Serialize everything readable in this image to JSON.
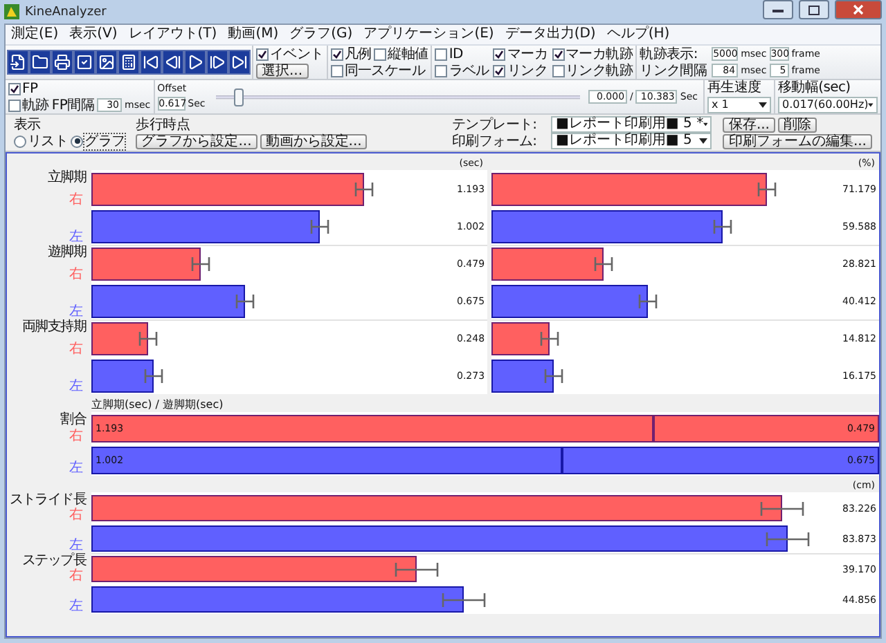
{
  "window": {
    "title": "KineAnalyzer"
  },
  "menu": [
    {
      "label": "測定(E)"
    },
    {
      "label": "表示(V)"
    },
    {
      "label": "レイアウト(T)"
    },
    {
      "label": "動画(M)"
    },
    {
      "label": "グラフ(G)"
    },
    {
      "label": "アプリケーション(E)"
    },
    {
      "label": "データ出力(D)"
    },
    {
      "label": "ヘルプ(H)"
    }
  ],
  "toolbar": {
    "events": {
      "label": "イベント",
      "checked": true
    },
    "select_button": "選択...",
    "legend": {
      "label": "凡例",
      "checked": true
    },
    "axis_values": {
      "label": "縦軸値",
      "checked": false
    },
    "same_scale": {
      "label": "同一スケール",
      "checked": false
    },
    "markers": [
      {
        "label": "ID",
        "checked": false
      },
      {
        "label": "マーカ",
        "checked": true
      },
      {
        "label": "マーカ軌跡",
        "checked": true
      },
      {
        "label": "ラベル",
        "checked": false
      },
      {
        "label": "リンク",
        "checked": true
      },
      {
        "label": "リンク軌跡",
        "checked": false
      }
    ],
    "trail_rows": [
      {
        "label": "軌跡表示:",
        "msec": "5000",
        "msec_unit": "msec",
        "frames": "300",
        "frame_unit": "frame"
      },
      {
        "label": "リンク間隔",
        "msec": "84",
        "msec_unit": "msec",
        "frames": "5",
        "frame_unit": "frame"
      }
    ],
    "fp": {
      "label": "FP",
      "checked": true
    },
    "fp_trail": {
      "label": "軌跡",
      "checked": false
    },
    "fp_interval": {
      "label": "FP間隔",
      "value": "30",
      "unit": "msec"
    }
  },
  "playback": {
    "offset_label": "Offset",
    "offset_value": "0.617",
    "offset_unit": "Sec",
    "level": 0.06,
    "current": "0.000",
    "separator": "/",
    "total": "10.383",
    "time_unit": "Sec",
    "speed_label": "再生速度",
    "speed": "x 1",
    "step_label": "移動幅(sec)",
    "step": "0.017(60.00Hz)"
  },
  "report": {
    "template_label": "テンプレート:",
    "template": "■レポート印刷用■ 5 *",
    "form_label": "印刷フォーム:",
    "form": "■レポート印刷用■ 5",
    "buttons": [
      "保存...",
      "削除",
      "印刷フォームの編集..."
    ]
  },
  "display": {
    "title": "表示",
    "options": [
      {
        "label": "リスト",
        "selected": false
      },
      {
        "label": "グラフ",
        "selected": true
      }
    ]
  },
  "gait_points": {
    "title": "歩行時点",
    "buttons": [
      "グラフから設定...",
      "動画から設定..."
    ]
  },
  "sections": [
    {
      "kind": "pair",
      "units": [
        "(sec)",
        "(%)"
      ],
      "groups": [
        {
          "label": "立脚期",
          "rows": [
            {
              "side": "右",
              "color": "#ff6060",
              "bars": [
                {
                  "level": 0.746,
                  "value": "1.193"
                },
                {
                  "level": 0.791,
                  "value": "71.179"
                }
              ]
            },
            {
              "side": "左",
              "color": "#6060ff",
              "bars": [
                {
                  "level": 0.626,
                  "value": "1.002"
                },
                {
                  "level": 0.662,
                  "value": "59.588"
                }
              ]
            }
          ]
        },
        {
          "label": "遊脚期",
          "rows": [
            {
              "side": "右",
              "color": "#ff6060",
              "bars": [
                {
                  "level": 0.299,
                  "value": "0.479"
                },
                {
                  "level": 0.32,
                  "value": "28.821"
                }
              ]
            },
            {
              "side": "左",
              "color": "#6060ff",
              "bars": [
                {
                  "level": 0.422,
                  "value": "0.675"
                },
                {
                  "level": 0.449,
                  "value": "40.412"
                }
              ]
            }
          ]
        },
        {
          "label": "両脚支持期",
          "rows": [
            {
              "side": "右",
              "color": "#ff6060",
              "bars": [
                {
                  "level": 0.155,
                  "value": "0.248"
                },
                {
                  "level": 0.165,
                  "value": "14.812"
                }
              ]
            },
            {
              "side": "左",
              "color": "#6060ff",
              "bars": [
                {
                  "level": 0.171,
                  "value": "0.273"
                },
                {
                  "level": 0.18,
                  "value": "16.175"
                }
              ]
            }
          ]
        }
      ]
    },
    {
      "kind": "ratio",
      "title": "立脚期(sec) / 遊脚期(sec)",
      "groups": [
        {
          "label": "割合",
          "rows": [
            {
              "side": "右",
              "color": "#ff6060",
              "level": 0.713,
              "values": [
                "1.193",
                "0.479"
              ]
            },
            {
              "side": "左",
              "color": "#6060ff",
              "level": 0.597,
              "values": [
                "1.002",
                "0.675"
              ]
            }
          ]
        }
      ]
    },
    {
      "kind": "single",
      "units": [
        "(cm)"
      ],
      "groups": [
        {
          "label": "ストライド長",
          "rows": [
            {
              "side": "右",
              "color": "#ff6060",
              "bars": [
                {
                  "level": 0.923,
                  "value": "83.226"
                }
              ]
            },
            {
              "side": "左",
              "color": "#6060ff",
              "bars": [
                {
                  "level": 0.93,
                  "value": "83.873"
                }
              ]
            }
          ]
        },
        {
          "label": "ステップ長",
          "rows": [
            {
              "side": "右",
              "color": "#ff6060",
              "bars": [
                {
                  "level": 0.434,
                  "value": "39.170"
                }
              ]
            },
            {
              "side": "左",
              "color": "#6060ff",
              "bars": [
                {
                  "level": 0.497,
                  "value": "44.856"
                }
              ]
            }
          ]
        }
      ]
    }
  ]
}
